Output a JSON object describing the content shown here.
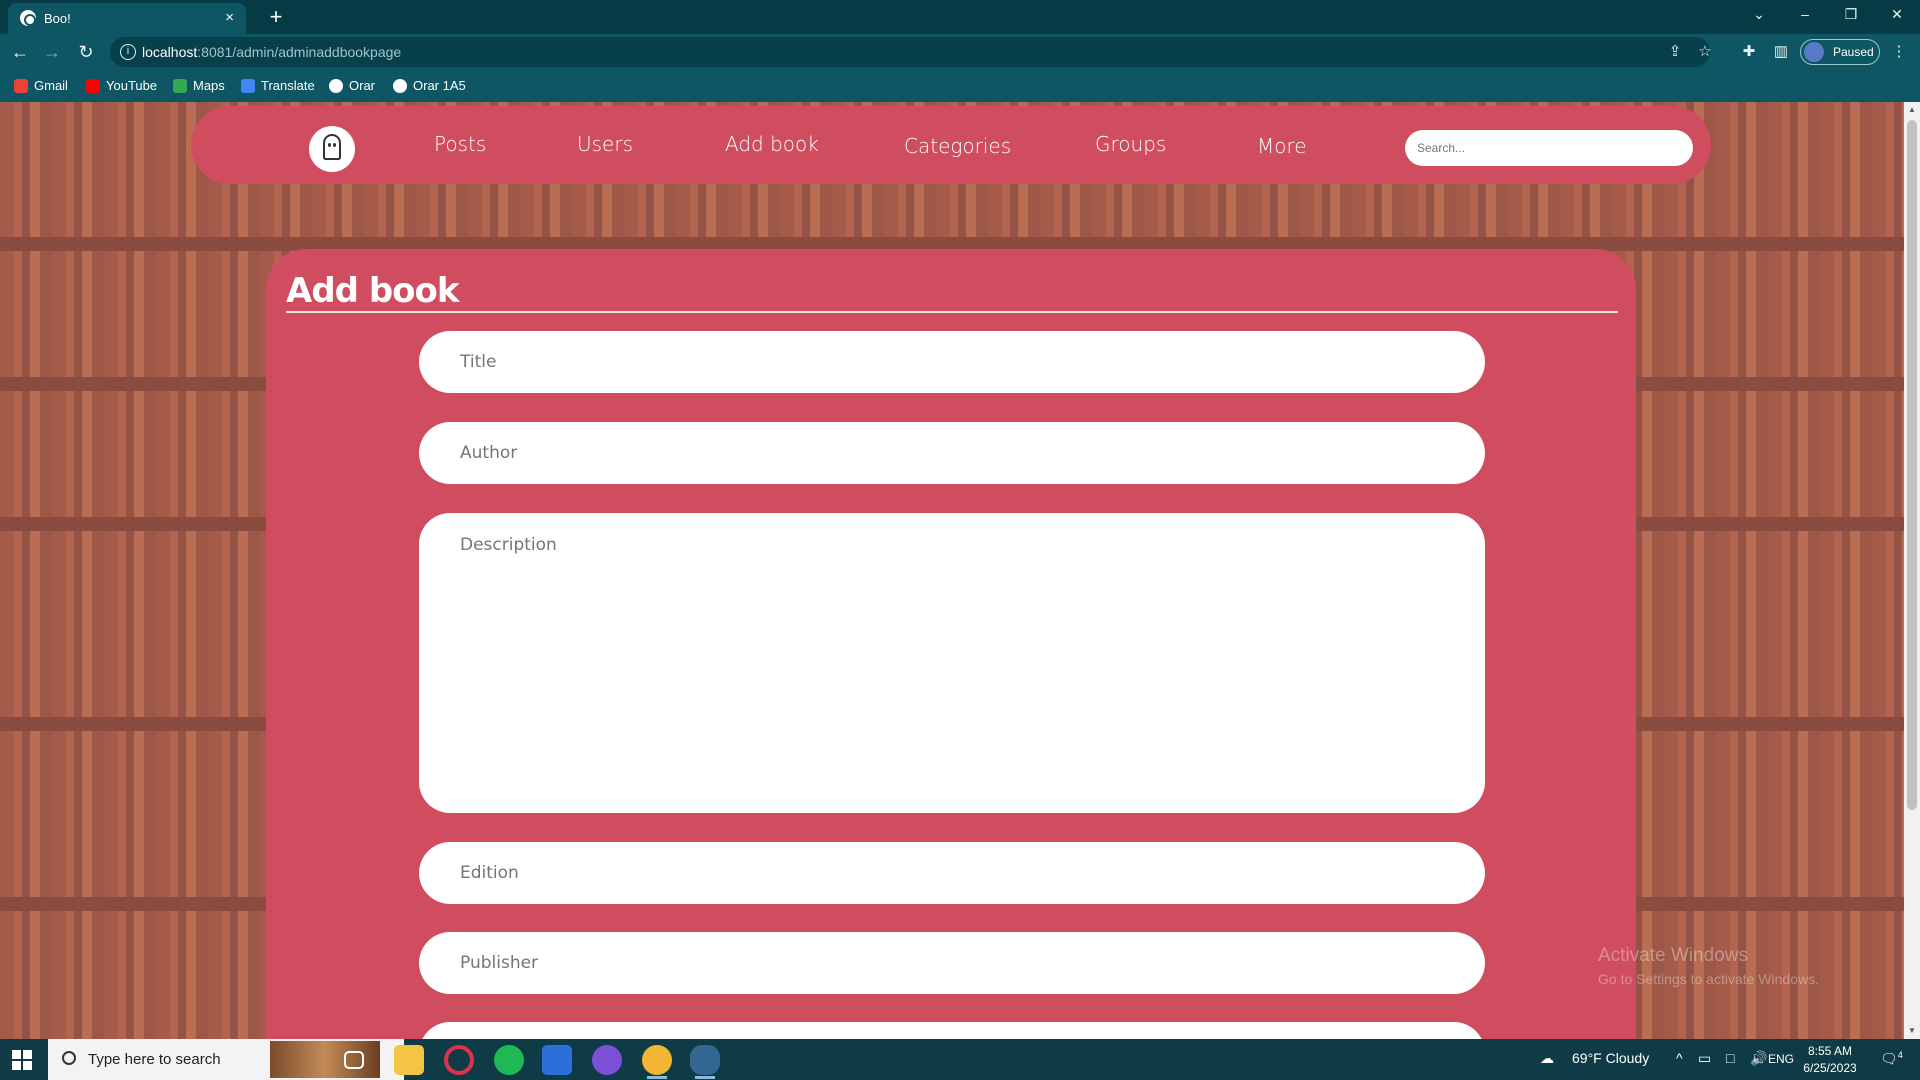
{
  "browser": {
    "tab_title": "Boo!",
    "tab_close": "×",
    "new_tab": "+",
    "url_host": "localhost",
    "url_rest": ":8081/admin/adminaddbookpage",
    "profile_label": "Paused",
    "bookmarks": [
      "Gmail",
      "YouTube",
      "Maps",
      "Translate",
      "Orar",
      "Orar 1A5"
    ]
  },
  "navbar": {
    "links": [
      "Posts",
      "Users",
      "Add book",
      "Categories",
      "Groups",
      "More"
    ],
    "search_placeholder": "Search..."
  },
  "form": {
    "title": "Add book",
    "fields": {
      "title": "Title",
      "author": "Author",
      "description": "Description",
      "edition": "Edition",
      "publisher": "Publisher"
    }
  },
  "watermark": {
    "line1": "Activate Windows",
    "line2": "Go to Settings to activate Windows."
  },
  "taskbar": {
    "search_placeholder": "Type here to search",
    "weather": "69°F  Cloudy",
    "language": "ENG",
    "time": "8:55 AM",
    "date": "6/25/2023",
    "notifications": "4"
  },
  "colors": {
    "accent": "#d04c5f",
    "browser_frame": "#0e5663"
  }
}
